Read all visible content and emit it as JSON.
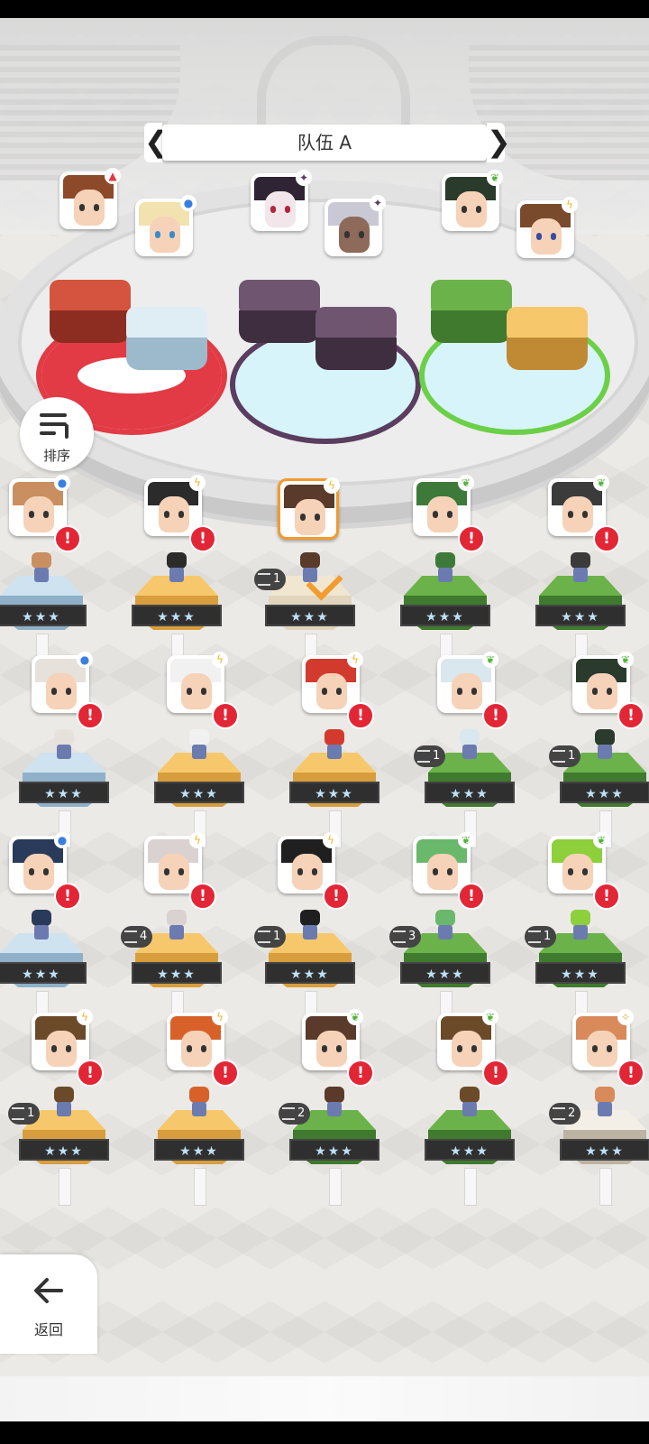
{
  "team": {
    "title": "队伍 A",
    "prev_arrow": "❮",
    "next_arrow": "❯"
  },
  "buttons": {
    "sort_label": "排序",
    "back_label": "返回"
  },
  "colors": {
    "accent": "#f29b2e",
    "alert": "#e32636",
    "fire": "#e23b45",
    "dark": "#5a3d5f",
    "nature": "#6bd047"
  },
  "team_slots": [
    {
      "element": "fire",
      "members": [
        "hero-1",
        "hero-2"
      ]
    },
    {
      "element": "dark",
      "members": [
        "hero-3",
        "hero-4"
      ]
    },
    {
      "element": "nature",
      "members": [
        "hero-5",
        "hero-6"
      ]
    }
  ],
  "roster": {
    "rows": [
      [
        {
          "stars": "★★★",
          "count": ""
        },
        {
          "stars": "★★★",
          "count": ""
        },
        {
          "stars": "★★★",
          "count": "1",
          "selected": true
        },
        {
          "stars": "★★★",
          "count": ""
        },
        {
          "stars": "★★★",
          "count": ""
        }
      ],
      [
        {
          "stars": "★★★",
          "count": ""
        },
        {
          "stars": "★★★",
          "count": ""
        },
        {
          "stars": "★★★",
          "count": ""
        },
        {
          "stars": "★★★",
          "count": "1"
        },
        {
          "stars": "★★★",
          "count": "1"
        }
      ],
      [
        {
          "stars": "★★★",
          "count": ""
        },
        {
          "stars": "★★★",
          "count": "4"
        },
        {
          "stars": "★★★",
          "count": "1"
        },
        {
          "stars": "★★★",
          "count": "3"
        },
        {
          "stars": "★★★",
          "count": "1"
        }
      ],
      [
        {
          "stars": "★★★",
          "count": "1"
        },
        {
          "stars": "★★★",
          "count": ""
        },
        {
          "stars": "★★★",
          "count": "2"
        },
        {
          "stars": "★★★",
          "count": ""
        },
        {
          "stars": "★★★",
          "count": "2"
        }
      ]
    ],
    "alert_symbol": "!"
  },
  "icons": [
    "sort-icon",
    "back-arrow-icon",
    "check-icon",
    "stack-icon",
    "element-lightning-icon",
    "element-leaf-icon",
    "element-water-icon",
    "element-dark-icon",
    "element-fire-icon",
    "element-light-icon"
  ]
}
